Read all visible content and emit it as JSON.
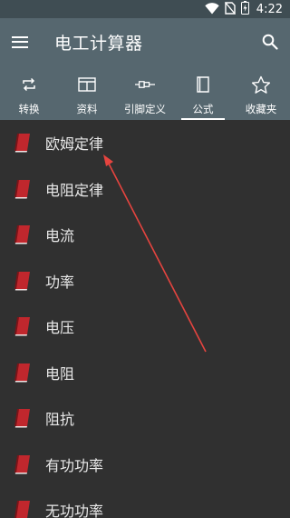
{
  "status_bar": {
    "time": "4:22",
    "icons": [
      "wifi-icon",
      "no-sim-icon",
      "battery-icon"
    ]
  },
  "app_bar": {
    "title": "电工计算器",
    "menu_icon": "hamburger-menu-icon",
    "search_icon": "search-icon",
    "background": "#56676f"
  },
  "tabs": [
    {
      "label": "转换",
      "icon": "repeat-icon",
      "active": false
    },
    {
      "label": "资料",
      "icon": "table-icon",
      "active": false
    },
    {
      "label": "引脚定义",
      "icon": "connector-icon",
      "active": false
    },
    {
      "label": "公式",
      "icon": "book-icon",
      "active": true
    },
    {
      "label": "收藏夹",
      "icon": "star-icon",
      "active": false
    }
  ],
  "list": {
    "item_icon": "formula-book-icon",
    "icon_color": "#c0272d",
    "items": [
      "欧姆定律",
      "电阻定律",
      "电流",
      "功率",
      "电压",
      "电阻",
      "阻抗",
      "有功功率",
      "无功功率"
    ]
  },
  "annotation": {
    "type": "arrow",
    "color": "#e5443f"
  }
}
